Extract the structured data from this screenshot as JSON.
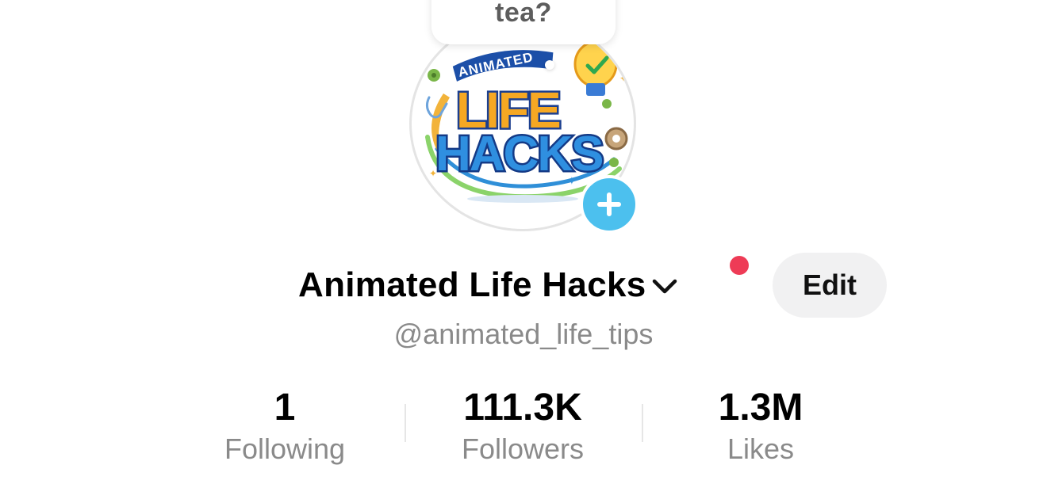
{
  "bubble": {
    "text": "tea?"
  },
  "avatar": {
    "image_name": "animated-life-hacks-logo",
    "logo_text_top": "ANIMATED",
    "logo_text_main_1": "LIFE",
    "logo_text_main_2": "HACKS"
  },
  "profile": {
    "display_name": "Animated Life Hacks",
    "handle": "@animated_life_tips",
    "edit_label": "Edit",
    "notification_color": "#ee3b56",
    "add_button_color": "#4cc0ee"
  },
  "stats": [
    {
      "value": "1",
      "label": "Following"
    },
    {
      "value": "111.3K",
      "label": "Followers"
    },
    {
      "value": "1.3M",
      "label": "Likes"
    }
  ]
}
